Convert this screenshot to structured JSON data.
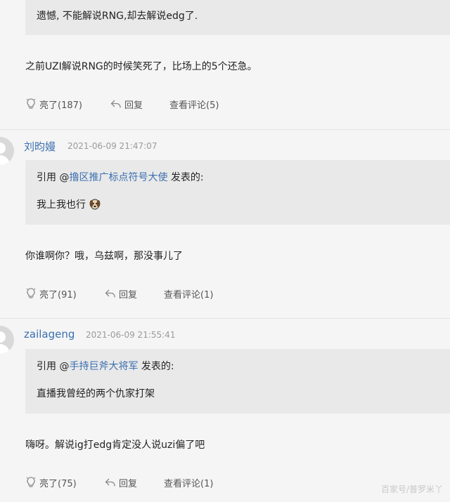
{
  "post1": {
    "quote_text": "遗憾, 不能解说RNG,却去解说edg了.",
    "body": "之前UZI解说RNG的时候笑死了，比场上的5个还急。",
    "like_label": "亮了(187)",
    "reply_label": "回复",
    "view_comments_label": "查看评论(5)"
  },
  "post2": {
    "username": "刘昀嫚",
    "timestamp": "2021-06-09 21:47:07",
    "quote_prefix": "引用 @",
    "quote_user": "撸区推广标点符号大使",
    "quote_suffix": " 发表的:",
    "quote_text": "我上我也行",
    "body": "你谁啊你？哦，乌兹啊，那没事儿了",
    "like_label": "亮了(91)",
    "reply_label": "回复",
    "view_comments_label": "查看评论(1)"
  },
  "post3": {
    "username": "zailageng",
    "timestamp": "2021-06-09 21:55:41",
    "quote_prefix": "引用 @",
    "quote_user": "手持巨斧大将军",
    "quote_suffix": " 发表的:",
    "quote_text": "直播我曾经的两个仇家打架",
    "body": "嗨呀。解说ig打edg肯定没人说uzi偏了吧",
    "like_label": "亮了(75)",
    "reply_label": "回复",
    "view_comments_label": "查看评论(1)"
  },
  "watermark": "百家号/普罗米丫",
  "colors": {
    "username": "#3a6fb0",
    "quote_bg": "#e9e9e9",
    "page_bg": "#f5f5f5"
  }
}
